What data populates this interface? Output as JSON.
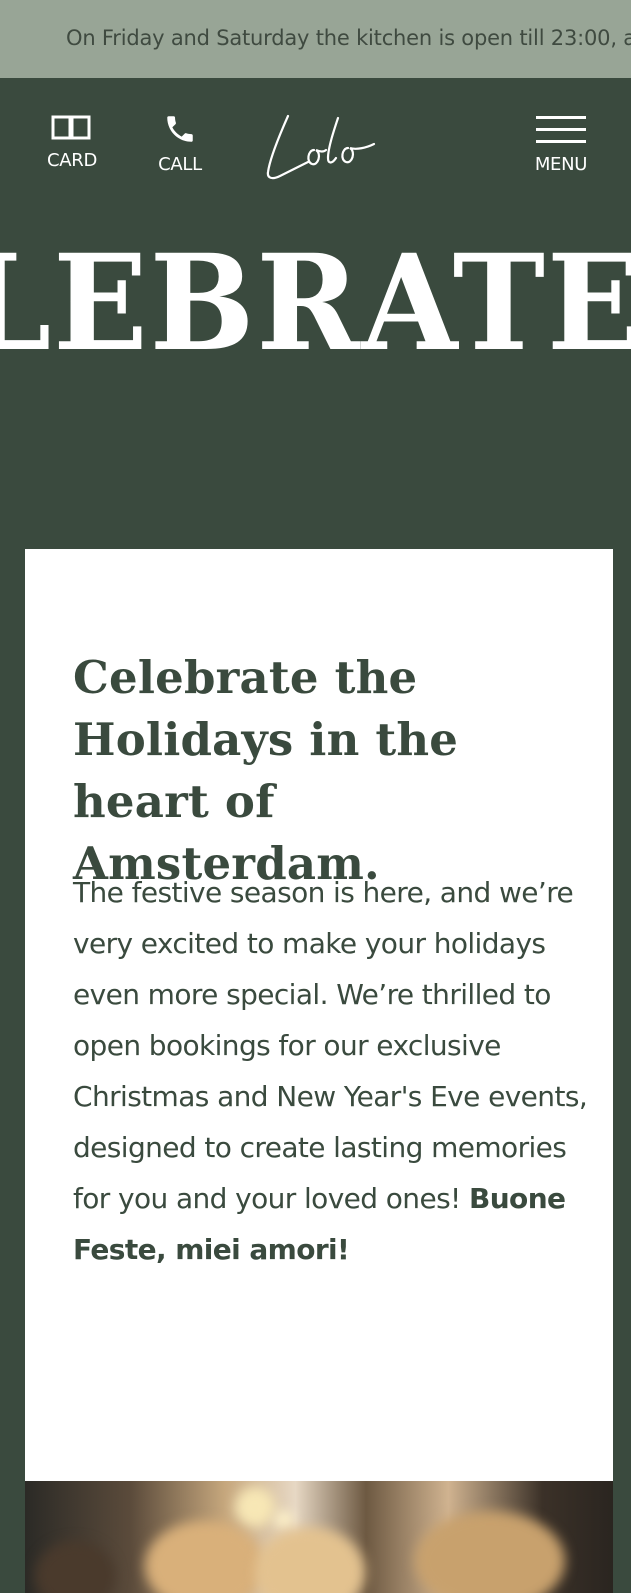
{
  "announcement": {
    "text": "On Friday and Saturday the kitchen is open till 23:00, a"
  },
  "header": {
    "card_label": "CARD",
    "call_label": "CALL",
    "logo_text": "Lolo",
    "menu_label": "MENU"
  },
  "hero": {
    "word": "LEBRATE TH"
  },
  "content": {
    "heading": "Celebrate the Holidays in the heart of Amsterdam.",
    "body": "The festive season is here, and we’re very excited to make your holidays even more special. We’re thrilled to open bookings for our exclusive Christmas and New Year's Eve events, designed to create lasting memories for you and your loved ones! ",
    "body_bold": "Buone Feste, miei amori!"
  },
  "colors": {
    "primary_green": "#3a4a3e",
    "announcement_bg": "#98a596",
    "panel_bg": "#ffffff",
    "text_on_dark": "#ffffff"
  },
  "icons": {
    "card": "book-open-icon",
    "call": "phone-icon",
    "menu": "hamburger-icon"
  }
}
